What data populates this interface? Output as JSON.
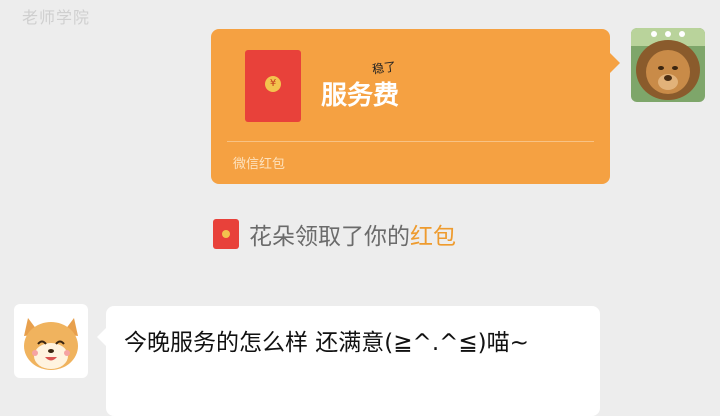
{
  "top_banner": "老师学院",
  "red_packet": {
    "sticker_text": "稳了",
    "title": "服务费",
    "footer": "微信红包",
    "coin_symbol": "¥"
  },
  "system_notice": {
    "prefix": "花朵领取了你的",
    "highlight": "红包"
  },
  "message": {
    "text": "今晚服务的怎么样 还满意(≧^.^≦)喵~"
  },
  "colors": {
    "bubble_orange": "#f5a142",
    "red_envelope": "#e8413a",
    "highlight": "#ee9b2e",
    "chat_background": "#ededed"
  }
}
